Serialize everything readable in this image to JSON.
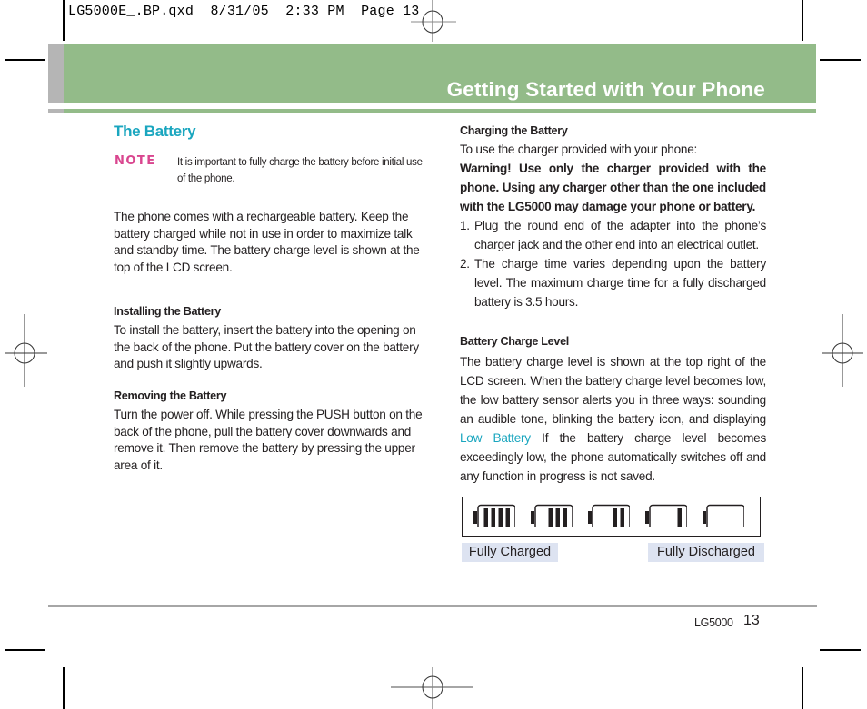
{
  "print_slug": {
    "filename": "LG5000E_.BP.qxd",
    "date": "8/31/05",
    "time": "2:33 PM",
    "page_label": "Page 13"
  },
  "header": {
    "title": "Getting Started with Your Phone",
    "colors": {
      "band": "#93bb89",
      "side_strip": "#b5b5b5",
      "title_text": "#ffffff"
    }
  },
  "left_column": {
    "section_title": "The Battery",
    "note": {
      "label": "NOTE",
      "text": "It is important to fully charge the battery before initial use of the phone."
    },
    "intro": "The phone comes with a rechargeable battery. Keep the battery charged while not in use in order to maximize talk and standby time. The battery charge level is shown at the top of the LCD screen.",
    "installing": {
      "heading": "Installing the Battery",
      "text": "To install the battery, insert the battery into the opening on the back of the phone. Put the battery cover on the battery and push it slightly upwards."
    },
    "removing": {
      "heading": "Removing the Battery",
      "text": "Turn the power off. While pressing the PUSH button on the back of the phone, pull the battery cover downwards and remove it. Then remove the battery by pressing the upper area of it."
    }
  },
  "right_column": {
    "charging": {
      "heading": "Charging the Battery",
      "intro": "To use the charger provided with your phone:",
      "warning": "Warning! Use only the charger provided with the phone. Using any charger other than the one included with the LG5000 may damage your phone or battery.",
      "steps": [
        {
          "num": "1.",
          "text": "Plug the round end of the adapter into the phone’s charger jack and the other end into an electrical outlet."
        },
        {
          "num": "2.",
          "text": "The charge time varies depending upon the battery level. The maximum charge time for a fully discharged battery is 3.5 hours."
        }
      ]
    },
    "charge_level": {
      "heading": "Battery Charge Level",
      "text_before": "The battery charge level is shown at the top right of the LCD screen. When the battery charge level becomes low, the low battery sensor alerts you in three ways: sounding an audible tone, blinking the battery icon, and displaying",
      "highlight": "Low Battery",
      "text_after": " If the battery charge level becomes exceedingly low, the phone automatically switches off and any function in progress is not saved."
    },
    "battery_levels": {
      "bars": [
        4,
        3,
        2,
        1,
        0
      ],
      "max_bars": 4,
      "caption_left": "Fully Charged",
      "caption_right": "Fully Discharged"
    }
  },
  "colors": {
    "accent": "#1aa6bf",
    "note": "#d9468f",
    "caption_bg": "#dde3f1"
  },
  "footer": {
    "model": "LG5000",
    "page_number": "13"
  }
}
